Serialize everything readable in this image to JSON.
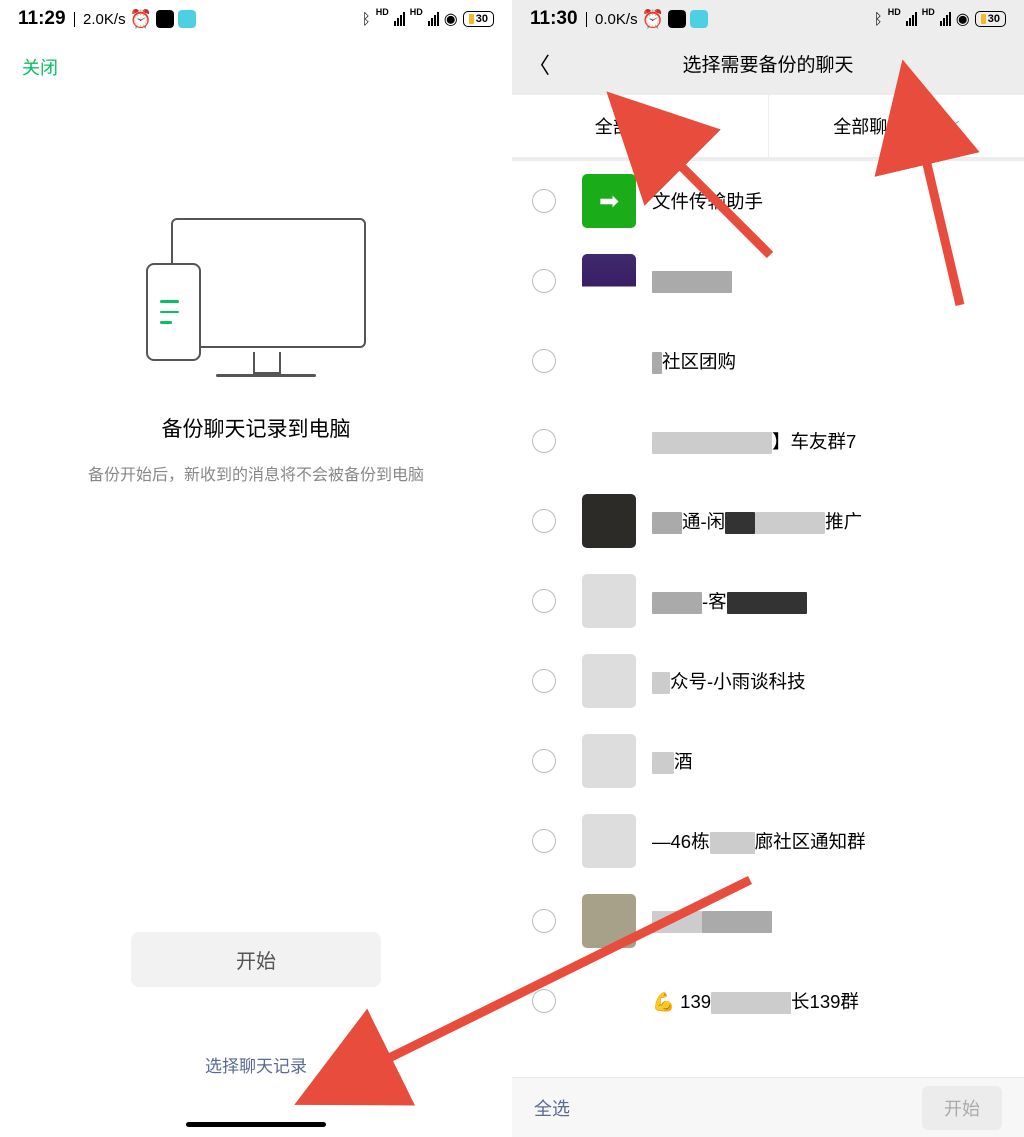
{
  "left": {
    "status": {
      "time": "11:29",
      "net": "2.0K/s",
      "batt": "30"
    },
    "close": "关闭",
    "title": "备份聊天记录到电脑",
    "subtitle": "备份开始后，新收到的消息将不会被备份到电脑",
    "start": "开始",
    "select_link": "选择聊天记录"
  },
  "right": {
    "status": {
      "time": "11:30",
      "net": "0.0K/s",
      "batt": "30"
    },
    "header_title": "选择需要备份的聊天",
    "filter_time": "全部时间",
    "filter_scope": "全部聊天记录",
    "chats": [
      {
        "name": "文件传输助手",
        "avatar": "file"
      },
      {
        "name": "",
        "avatar": "purple"
      },
      {
        "name_pre": "",
        "name_post": "社区团购",
        "avatar": "grid"
      },
      {
        "name_pre": "",
        "name_mid": "】车友群7",
        "avatar": "grid2"
      },
      {
        "name_pre": "通-闲",
        "name_post": "推广",
        "avatar": "dark"
      },
      {
        "name_pre": "",
        "name_post": "-客",
        "avatar": "split"
      },
      {
        "name_pre": "众号-小雨谈科技",
        "avatar": "split2"
      },
      {
        "name_pre": "酒",
        "avatar": "split3"
      },
      {
        "name_pre": "—46栋",
        "name_post": "廊社区通知群",
        "avatar": "split4"
      },
      {
        "name_pre": "",
        "avatar": "gray"
      },
      {
        "name_pre": "💪 139",
        "name_post": "长139群",
        "avatar": "grid3"
      }
    ],
    "select_all": "全选",
    "start": "开始"
  }
}
